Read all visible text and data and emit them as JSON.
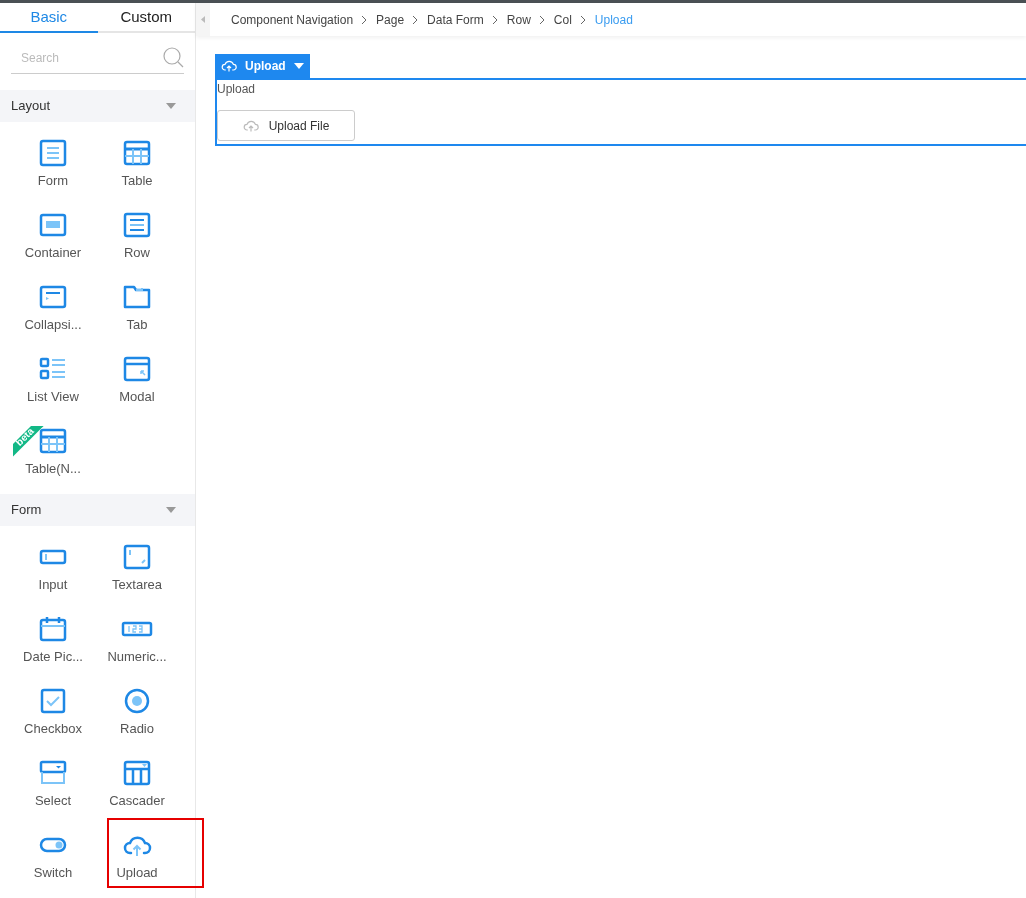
{
  "sidebar": {
    "tabs": [
      {
        "label": "Basic",
        "selected": true
      },
      {
        "label": "Custom",
        "selected": false
      }
    ],
    "search": {
      "placeholder": "Search"
    },
    "sections": [
      {
        "title": "Layout",
        "expanded": true,
        "items": [
          {
            "label": "Form",
            "kind": "form",
            "highlighted": false
          },
          {
            "label": "Table",
            "kind": "table",
            "highlighted": false
          },
          {
            "label": "Container",
            "kind": "container",
            "highlighted": false
          },
          {
            "label": "Row",
            "kind": "row",
            "highlighted": false
          },
          {
            "label": "Collapsi...",
            "kind": "collapse",
            "highlighted": false
          },
          {
            "label": "Tab",
            "kind": "tab",
            "highlighted": false
          },
          {
            "label": "List View",
            "kind": "list",
            "highlighted": false
          },
          {
            "label": "Modal",
            "kind": "modal",
            "highlighted": false
          },
          {
            "label": "Table(N...",
            "kind": "table",
            "badge": "beta",
            "highlighted": false
          }
        ]
      },
      {
        "title": "Form",
        "expanded": true,
        "items": [
          {
            "label": "Input",
            "kind": "input",
            "highlighted": false
          },
          {
            "label": "Textarea",
            "kind": "textarea",
            "highlighted": false
          },
          {
            "label": "Date Pic...",
            "kind": "date",
            "highlighted": false
          },
          {
            "label": "Numeric...",
            "kind": "numeric",
            "highlighted": false
          },
          {
            "label": "Checkbox",
            "kind": "checkbox",
            "highlighted": false
          },
          {
            "label": "Radio",
            "kind": "radio",
            "highlighted": false
          },
          {
            "label": "Select",
            "kind": "select",
            "highlighted": false
          },
          {
            "label": "Cascader",
            "kind": "cascader",
            "highlighted": false
          },
          {
            "label": "Switch",
            "kind": "switch",
            "highlighted": false
          },
          {
            "label": "Upload",
            "kind": "upload",
            "highlighted": true
          }
        ]
      }
    ]
  },
  "breadcrumb": [
    {
      "label": "Component Navigation",
      "selected": false
    },
    {
      "label": "Page",
      "selected": false
    },
    {
      "label": "Data Form",
      "selected": false
    },
    {
      "label": "Row",
      "selected": false
    },
    {
      "label": "Col",
      "selected": false
    },
    {
      "label": "Upload",
      "selected": true
    }
  ],
  "canvas": {
    "component_tag": "Upload",
    "field_label": "Upload",
    "upload_button": "Upload File"
  }
}
